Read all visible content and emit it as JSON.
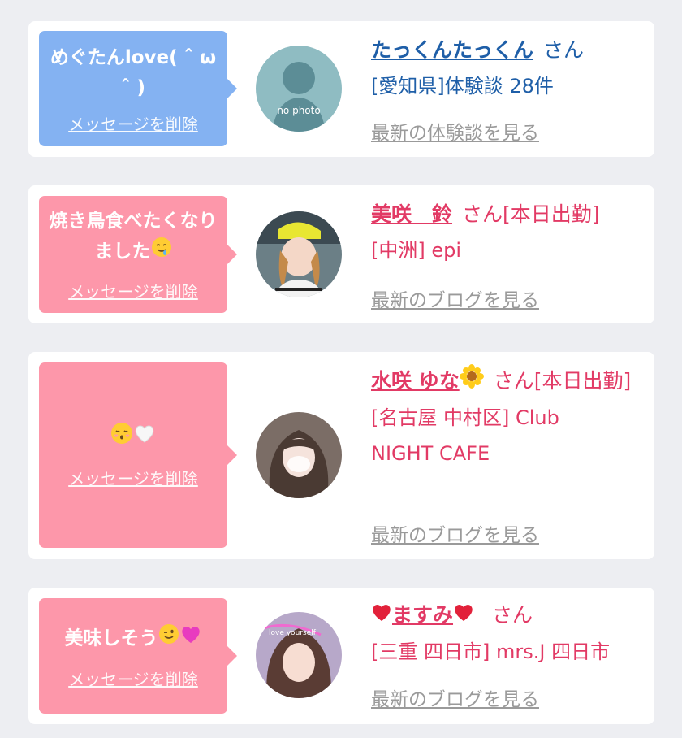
{
  "messages": [
    {
      "bubble_text": "めぐたんlove( ˆ ω ˆ )",
      "delete_label": "メッセージを削除",
      "name": "たっくんたっくん",
      "san": "さん",
      "sub": "[愛知県]体験談 28件",
      "more_link": "最新の体験談を見る",
      "avatar_text": "no photo"
    },
    {
      "bubble_text": "焼き鳥食べたくなりました",
      "delete_label": "メッセージを削除",
      "name": "美咲　鈴",
      "san": "さん[本日出勤]",
      "sub": "[中洲] epi",
      "more_link": "最新のブログを見る"
    },
    {
      "delete_label": "メッセージを削除",
      "name": "水咲 ゆな",
      "san": "さん[本日出勤]",
      "sub1": "[名古屋 中村区] Club",
      "sub2": "NIGHT CAFE",
      "more_link": "最新のブログを見る"
    },
    {
      "bubble_text": "美味しそう",
      "delete_label": "メッセージを削除",
      "name": "ますみ",
      "san": "さん",
      "sub": "[三重 四日市] mrs.J 四日市",
      "more_link": "最新のブログを見る",
      "avatar_text": "love yourself"
    }
  ],
  "colors": {
    "blue_bubble": "#84b2f2",
    "pink_bubble": "#fd97aa",
    "blue_text": "#1f5fa8",
    "pink_text": "#e23a65"
  }
}
